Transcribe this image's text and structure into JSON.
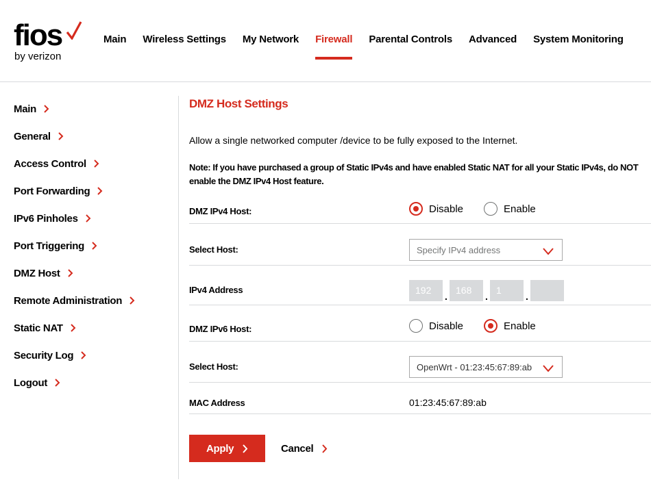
{
  "brand": {
    "logo_word": "fios",
    "logo_sub": "by verizon",
    "accent_color": "#d52b1e"
  },
  "topnav": {
    "items": [
      {
        "label": "Main",
        "active": false
      },
      {
        "label": "Wireless Settings",
        "active": false
      },
      {
        "label": "My Network",
        "active": false
      },
      {
        "label": "Firewall",
        "active": true
      },
      {
        "label": "Parental Controls",
        "active": false
      },
      {
        "label": "Advanced",
        "active": false
      },
      {
        "label": "System Monitoring",
        "active": false
      }
    ]
  },
  "sidebar": {
    "items": [
      {
        "label": "Main"
      },
      {
        "label": "General"
      },
      {
        "label": "Access Control"
      },
      {
        "label": "Port Forwarding"
      },
      {
        "label": "IPv6 Pinholes"
      },
      {
        "label": "Port Triggering"
      },
      {
        "label": "DMZ Host"
      },
      {
        "label": "Remote Administration"
      },
      {
        "label": "Static NAT"
      },
      {
        "label": "Security Log"
      },
      {
        "label": "Logout"
      }
    ]
  },
  "main": {
    "title": "DMZ Host Settings",
    "description": "Allow a single networked computer /device to be fully exposed to the Internet.",
    "note": "Note: If you have purchased a group of Static IPv4s and have enabled Static NAT for all your Static IPv4s, do NOT enable the DMZ IPv4 Host feature.",
    "ipv4_host": {
      "label": "DMZ IPv4 Host:",
      "disable_label": "Disable",
      "enable_label": "Enable",
      "selected": "Disable"
    },
    "ipv4_select": {
      "label": "Select Host:",
      "placeholder": "Specify IPv4 address"
    },
    "ipv4_address": {
      "label": "IPv4 Address",
      "octets": [
        "192",
        "168",
        "1",
        ""
      ]
    },
    "ipv6_host": {
      "label": "DMZ IPv6 Host:",
      "disable_label": "Disable",
      "enable_label": "Enable",
      "selected": "Enable"
    },
    "ipv6_select": {
      "label": "Select Host:",
      "value": "OpenWrt - 01:23:45:67:89:ab"
    },
    "mac": {
      "label": "MAC Address",
      "value": "01:23:45:67:89:ab"
    },
    "apply_label": "Apply",
    "cancel_label": "Cancel"
  }
}
